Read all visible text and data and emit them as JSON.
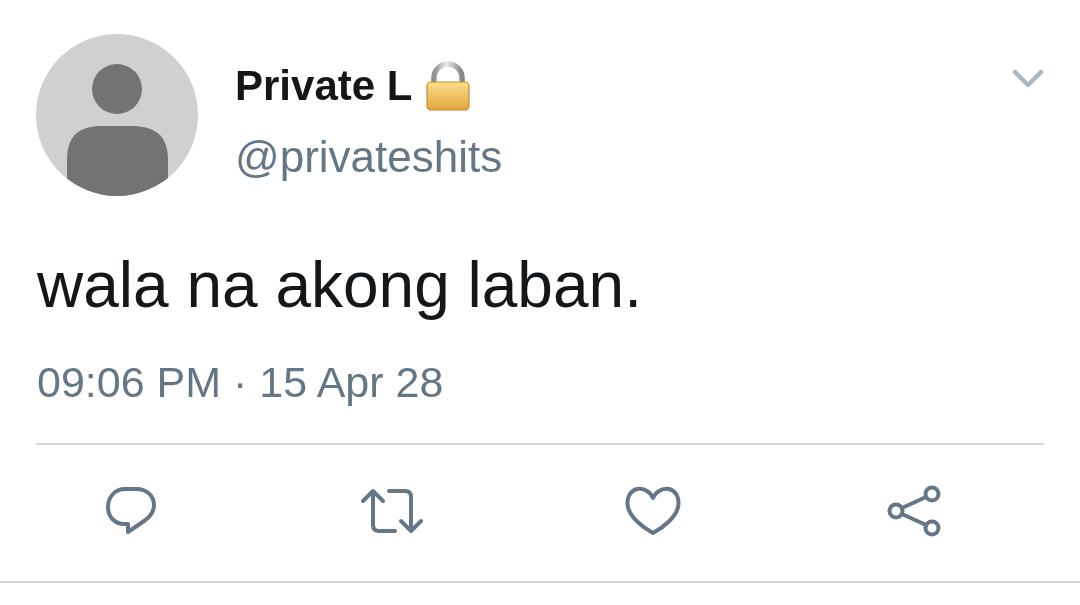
{
  "author": {
    "name": "Private L",
    "protected": true,
    "handle": "@privateshits"
  },
  "tweet": {
    "text": "wala na akong laban.",
    "timestamp": "09:06 PM · 15 Apr 28"
  },
  "actions": [
    {
      "kind": "reply"
    },
    {
      "kind": "retweet"
    },
    {
      "kind": "like"
    },
    {
      "kind": "share"
    }
  ]
}
